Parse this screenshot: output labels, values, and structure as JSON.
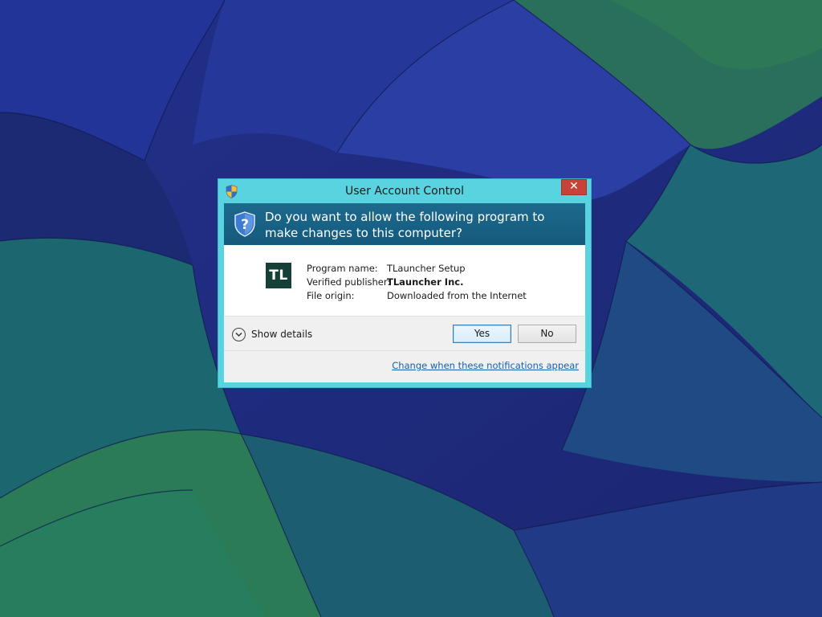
{
  "dialog": {
    "title": "User Account Control",
    "close_label": "✕",
    "question": "Do you want to allow the following program to make changes to this computer?",
    "app_icon_text": "TL",
    "program": {
      "name_label": "Program name:",
      "name_value": "TLauncher Setup",
      "publisher_label": "Verified publisher:",
      "publisher_value": "TLauncher Inc.",
      "origin_label": "File origin:",
      "origin_value": "Downloaded from the Internet"
    },
    "show_details_label": "Show details",
    "yes_label": "Yes",
    "no_label": "No",
    "change_link": "Change when these notifications appear"
  },
  "icons": {
    "title_shield": "uac-shield-icon",
    "header_shield": "uac-question-shield-icon",
    "chevron": "chevron-down-icon"
  },
  "colors": {
    "frame": "#5ad3e0",
    "header": "#1c6a8e",
    "close": "#c9423a",
    "link": "#1561b0",
    "desktop_dark": "#1e2d7a",
    "desktop_teal": "#1d6e78",
    "desktop_green": "#2a7a55"
  }
}
